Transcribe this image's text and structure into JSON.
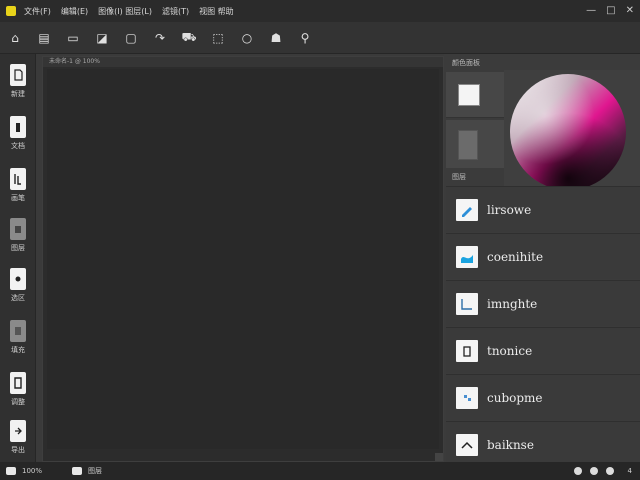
{
  "menubar": {
    "items": [
      "文件(F)",
      "编辑(E)",
      "图像(I) 图层(L)",
      "滤镜(T)",
      "视图 帮助"
    ],
    "window_controls": [
      "—",
      "□",
      "✕"
    ],
    "app_color": "#e8d31a"
  },
  "toolbar": {
    "tools": [
      {
        "name": "home-icon",
        "glyph": "⌂"
      },
      {
        "name": "document-icon",
        "glyph": "▤"
      },
      {
        "name": "image-icon",
        "glyph": "▭"
      },
      {
        "name": "picture-icon",
        "glyph": "◪"
      },
      {
        "name": "frame-icon",
        "glyph": "▢"
      },
      {
        "name": "rotate-icon",
        "glyph": "↷"
      },
      {
        "name": "car-icon",
        "glyph": "⛟"
      },
      {
        "name": "crop-icon",
        "glyph": "⬚"
      },
      {
        "name": "circle-icon",
        "glyph": "○"
      },
      {
        "name": "person-icon",
        "glyph": "☗"
      },
      {
        "name": "shirt-icon",
        "glyph": "⚲"
      }
    ]
  },
  "leftrail": {
    "items": [
      {
        "label": "新建",
        "dim": false
      },
      {
        "label": "文档",
        "dim": false
      },
      {
        "label": "画笔",
        "dim": false
      },
      {
        "label": "图层",
        "dim": true
      },
      {
        "label": "选区",
        "dim": false
      },
      {
        "label": "填充",
        "dim": true
      },
      {
        "label": "调整",
        "dim": false
      },
      {
        "label": "导出",
        "dim": false
      }
    ]
  },
  "canvas": {
    "tab_label": "未命名-1 @ 100%"
  },
  "rightpanel": {
    "swatch_header": "颜色面板",
    "section_label": "图层",
    "layers": [
      {
        "name": "lirsowe",
        "icon": "pen-icon"
      },
      {
        "name": "coenihite",
        "icon": "wave-icon"
      },
      {
        "name": "imnghte",
        "icon": "chart-icon"
      },
      {
        "name": "tnonice",
        "icon": "doc-icon"
      },
      {
        "name": "cubopme",
        "icon": "grid-icon"
      },
      {
        "name": "baiknse",
        "icon": "chevron-icon"
      }
    ]
  },
  "statusbar": {
    "left_1": "100%",
    "left_2": "图层",
    "right_count": "4"
  }
}
